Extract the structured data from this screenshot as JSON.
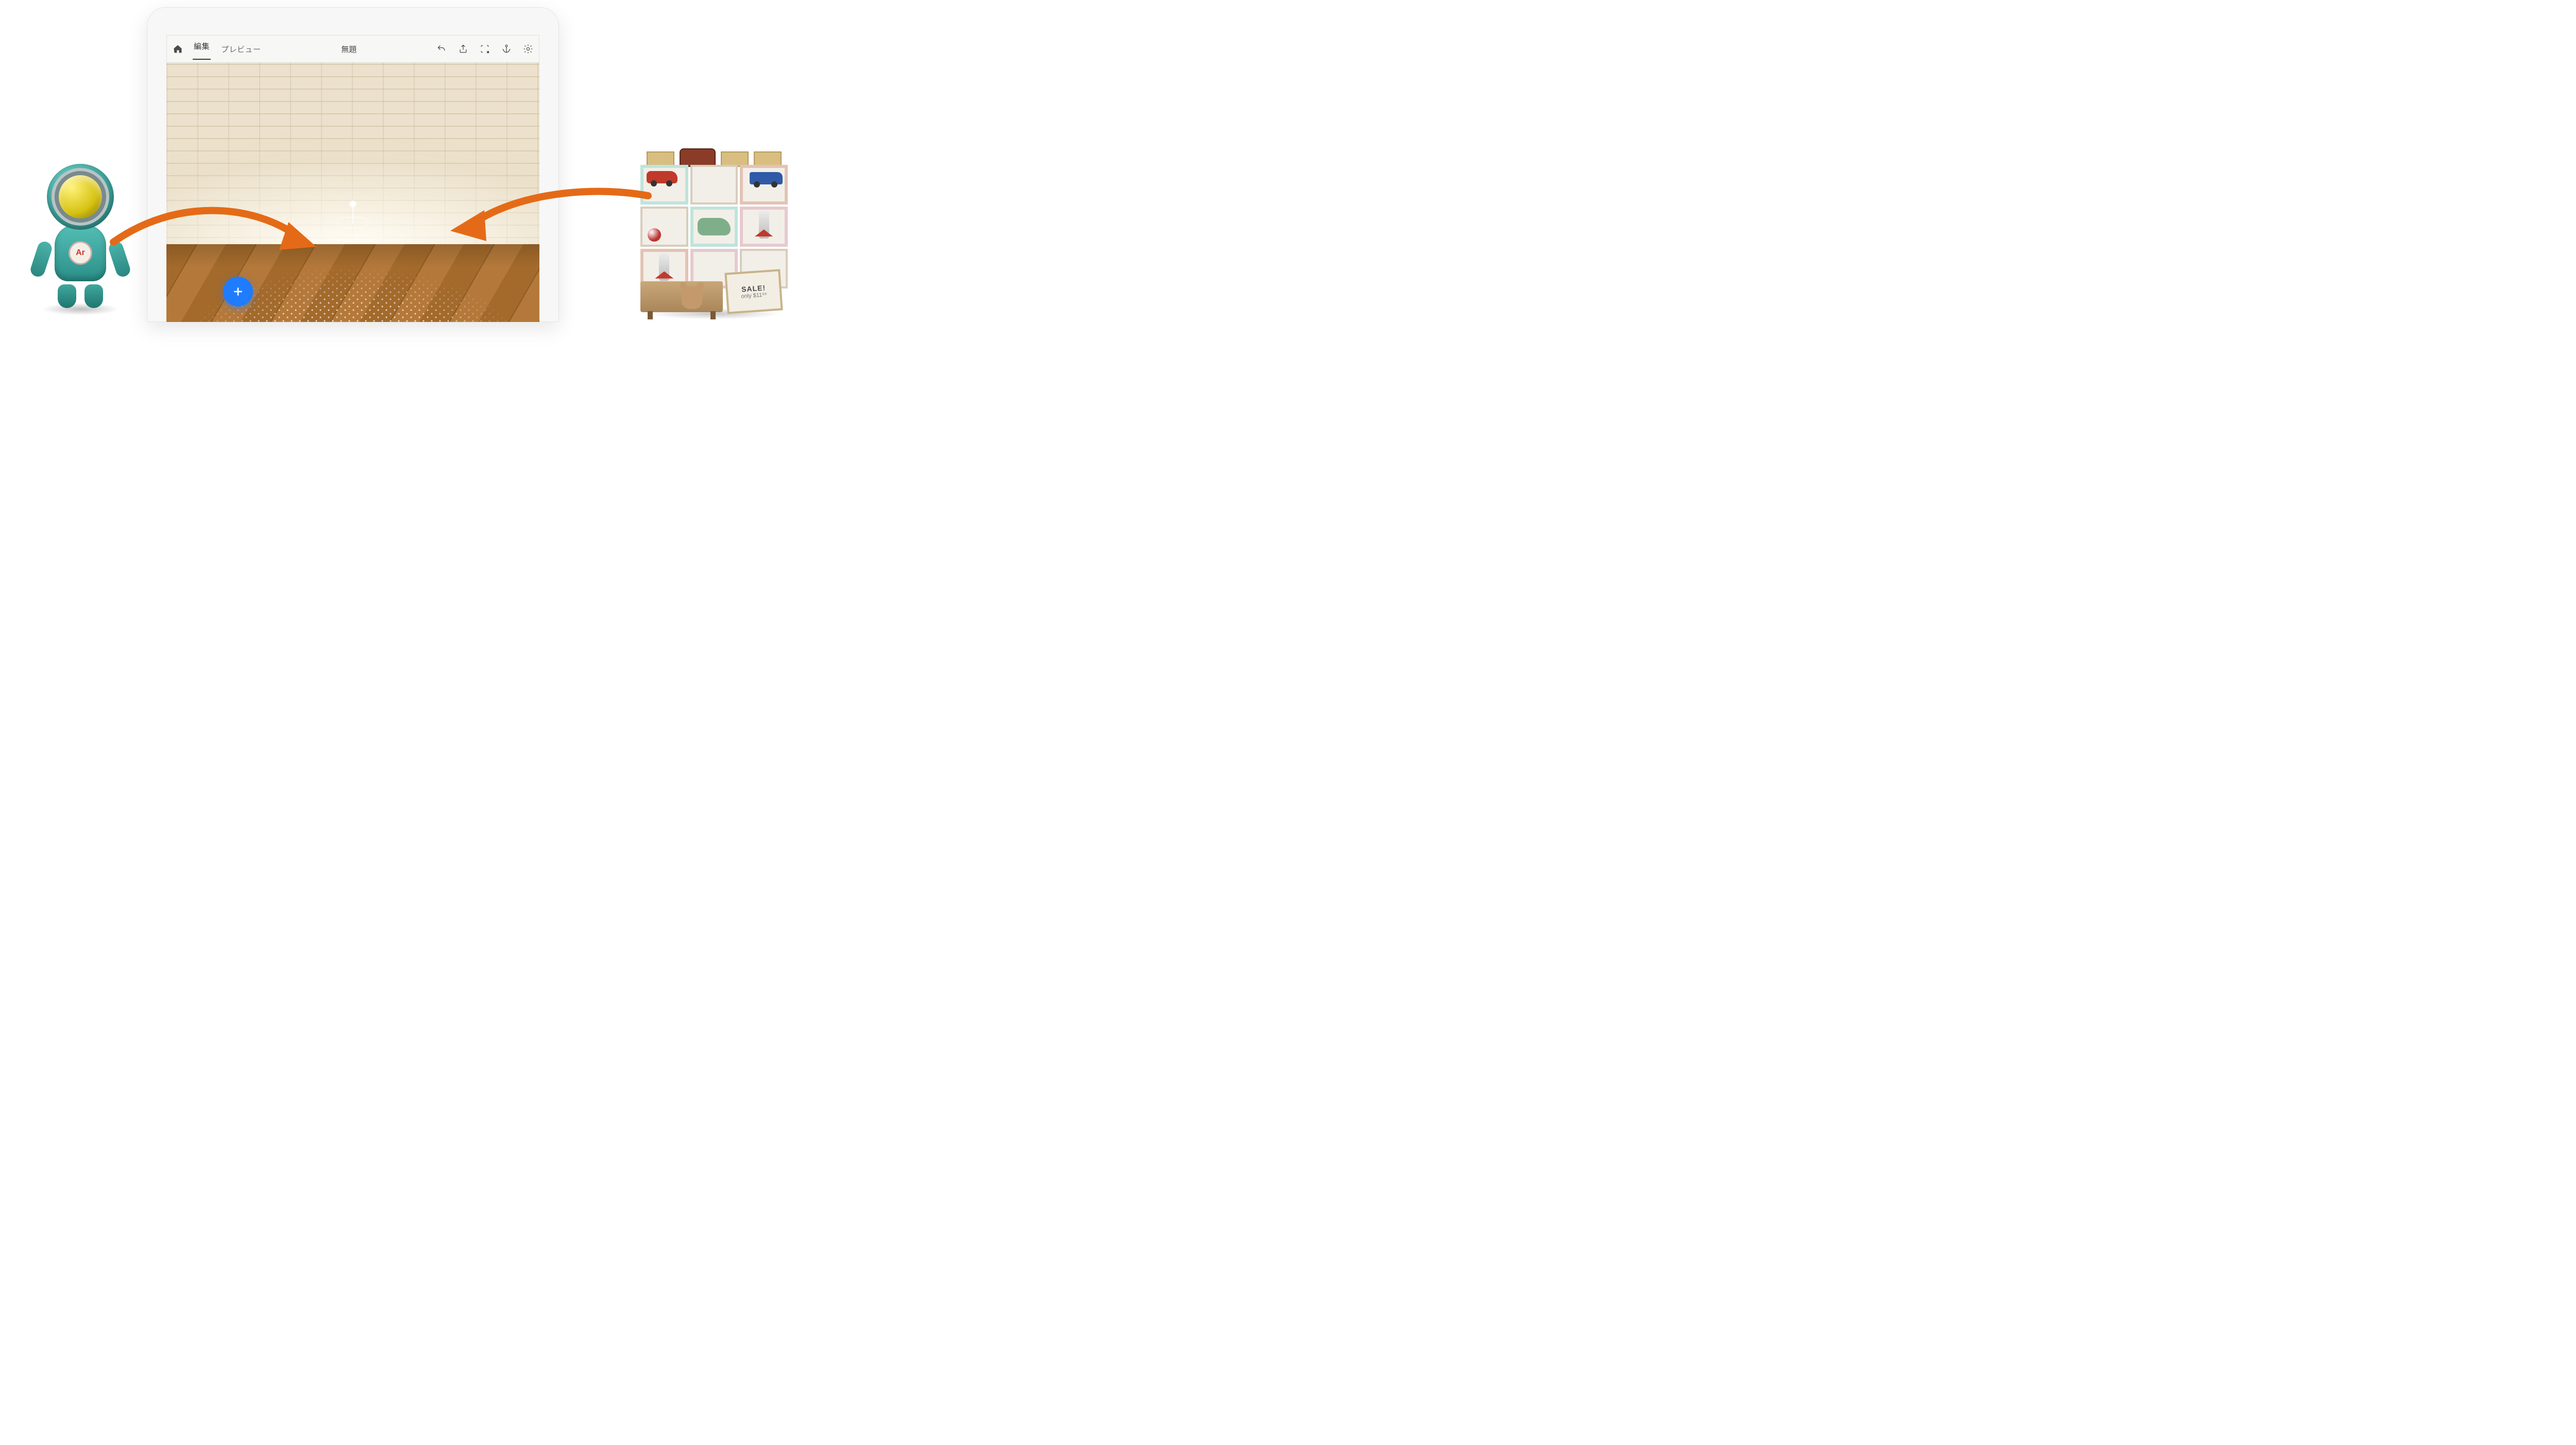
{
  "toolbar": {
    "tab_edit": "編集",
    "tab_preview": "プレビュー"
  },
  "document": {
    "title": "無題"
  },
  "icons": {
    "home": "home-icon",
    "undo": "undo-icon",
    "share": "share-icon",
    "select_area": "select-area-icon",
    "anchor": "anchor-icon",
    "settings": "gear-icon",
    "add": "plus-icon"
  },
  "left_character": {
    "badge": "Ar"
  },
  "right_shelf": {
    "sale_card_line1": "SALE!",
    "sale_card_line2": "only $11⁹⁹"
  }
}
